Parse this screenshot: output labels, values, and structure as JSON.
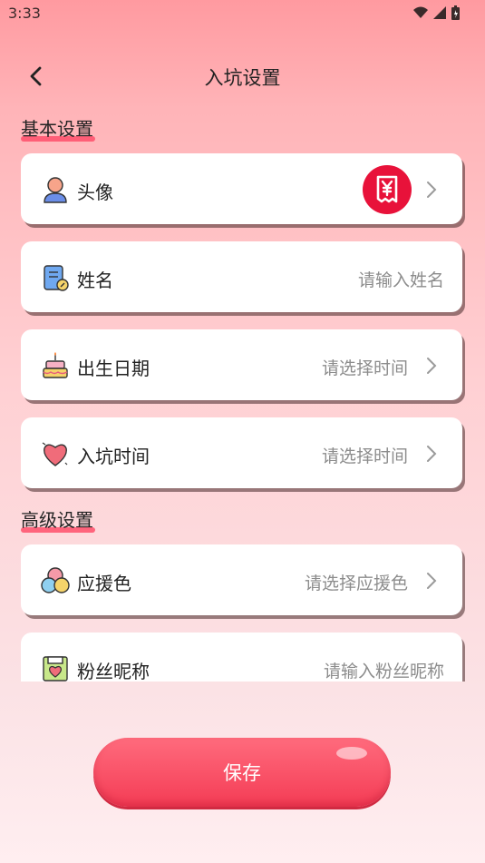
{
  "status": {
    "time": "3:33"
  },
  "header": {
    "title": "入坑设置"
  },
  "sections": {
    "basic": "基本设置",
    "advanced": "高级设置"
  },
  "rows": {
    "avatar": {
      "label": "头像"
    },
    "name": {
      "label": "姓名",
      "placeholder": "请输入姓名"
    },
    "birthday": {
      "label": "出生日期",
      "value": "请选择时间"
    },
    "join_time": {
      "label": "入坑时间",
      "value": "请选择时间"
    },
    "support_color": {
      "label": "应援色",
      "value": "请选择应援色"
    },
    "fan_nickname": {
      "label": "粉丝昵称",
      "placeholder": "请输入粉丝昵称"
    }
  },
  "save_label": "保存",
  "icons": {
    "back": "chevron-left-icon",
    "avatar_badge": "yen-receipt-icon",
    "chevron": "chevron-right-icon"
  },
  "colors": {
    "accent": "#f43c55",
    "badge": "#e8123a"
  }
}
